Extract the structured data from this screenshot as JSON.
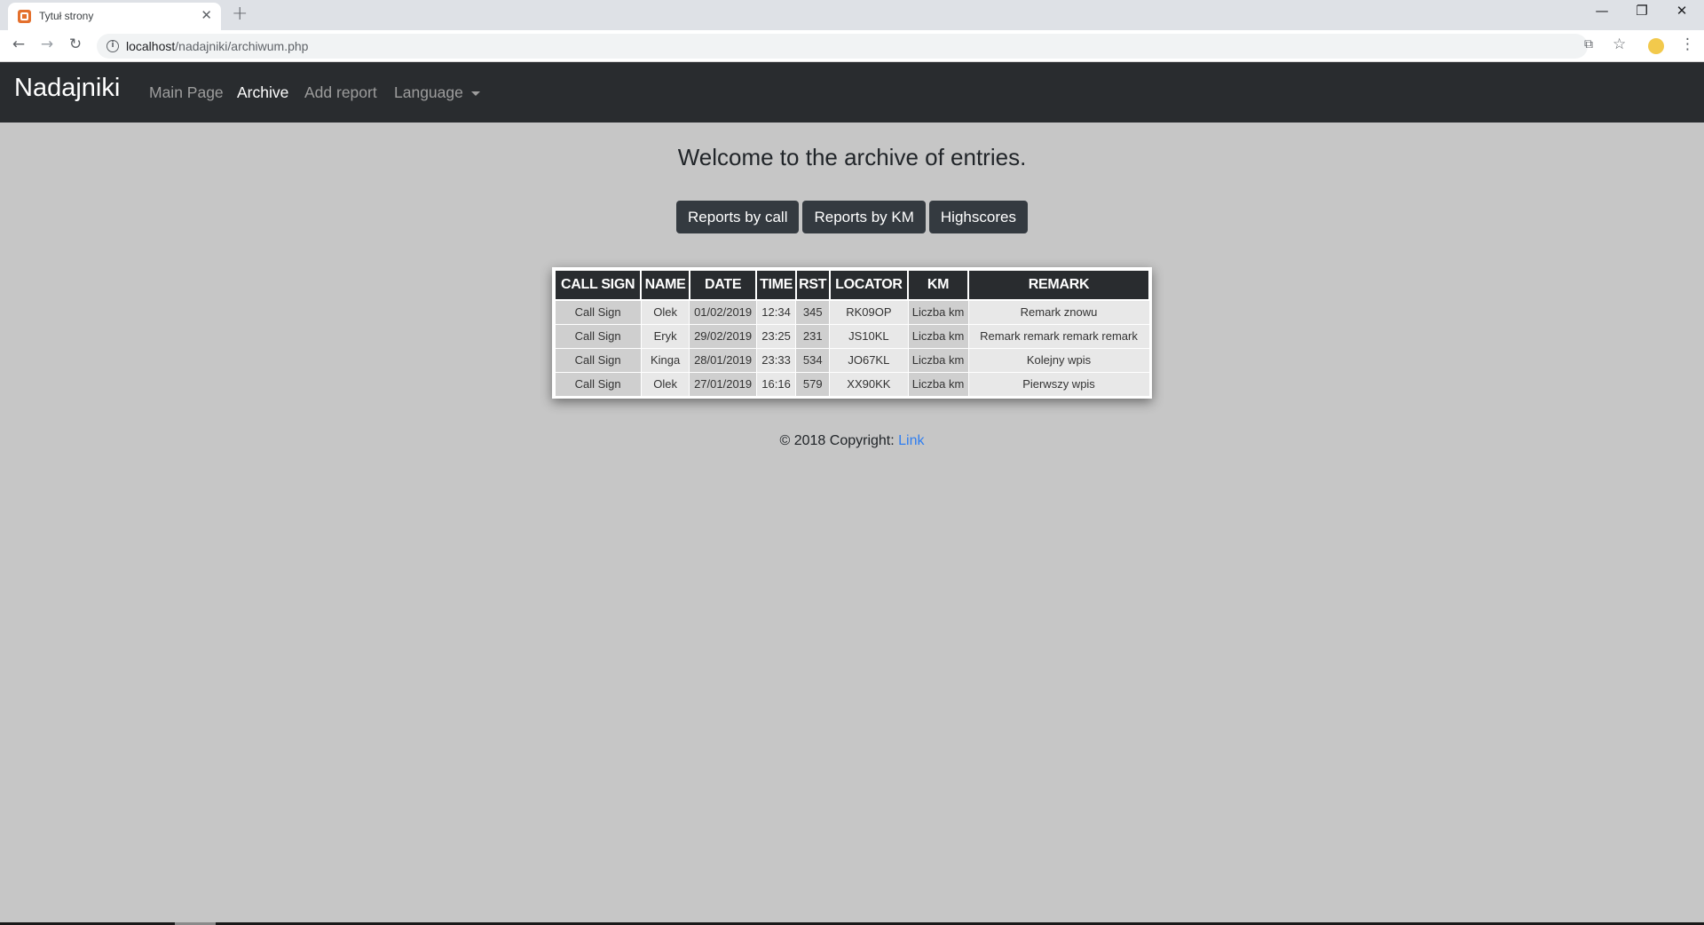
{
  "browser": {
    "tab_title": "Tytuł strony",
    "tab_close": "✕",
    "new_tab": "+",
    "window_minimize": "—",
    "window_restore": "❐",
    "window_close": "✕",
    "url_host": "localhost",
    "url_path": "/nadajniki/archiwum.php",
    "icons": {
      "back": "back-arrow-icon",
      "forward": "forward-arrow-icon",
      "reload": "reload-icon",
      "info": "info-icon",
      "translate": "translate-icon",
      "bookmark": "star-icon",
      "profile": "profile-avatar-icon",
      "menu": "menu-dots-icon"
    }
  },
  "navbar": {
    "brand": "Nadajniki",
    "links": {
      "main": "Main Page",
      "archive": "Archive",
      "add": "Add report",
      "language": "Language"
    },
    "active": "Archive"
  },
  "main": {
    "title": "Welcome to the archive of entries.",
    "buttons": {
      "by_call": "Reports by call",
      "by_km": "Reports by KM",
      "highscores": "Highscores"
    }
  },
  "table": {
    "headers": [
      "CALL SIGN",
      "NAME",
      "DATE",
      "TIME",
      "RST",
      "LOCATOR",
      "KM",
      "REMARK"
    ],
    "rows": [
      [
        "Call Sign",
        "Olek",
        "01/02/2019",
        "12:34",
        "345",
        "RK09OP",
        "Liczba km",
        "Remark znowu"
      ],
      [
        "Call Sign",
        "Eryk",
        "29/02/2019",
        "23:25",
        "231",
        "JS10KL",
        "Liczba km",
        "Remark remark remark remark"
      ],
      [
        "Call Sign",
        "Kinga",
        "28/01/2019",
        "23:33",
        "534",
        "JO67KL",
        "Liczba km",
        "Kolejny wpis"
      ],
      [
        "Call Sign",
        "Olek",
        "27/01/2019",
        "16:16",
        "579",
        "XX90KK",
        "Liczba km",
        "Pierwszy wpis"
      ]
    ]
  },
  "footer": {
    "text": "© 2018 Copyright: ",
    "link": "Link"
  },
  "colors": {
    "page_bg": "#c6c6c6",
    "navbar_bg": "#292c2f",
    "button_bg": "#343a40",
    "link": "#2f7ef0"
  }
}
